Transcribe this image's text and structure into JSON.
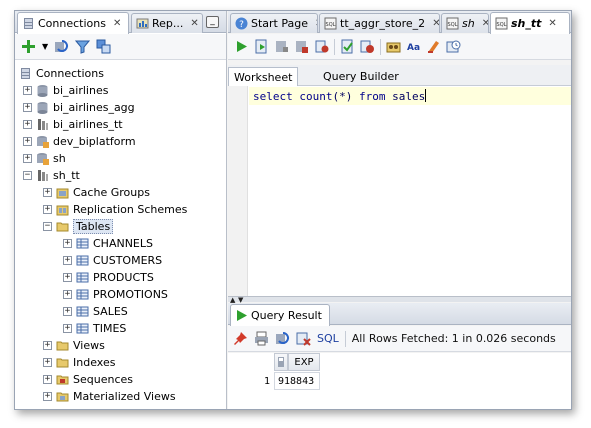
{
  "colors": {
    "accent": "#1e3fa0",
    "editor_line": "#ffffdd",
    "selection": "#dde6f3"
  },
  "left_panel": {
    "tabs": [
      {
        "label": "Connections",
        "icon": "connections-icon",
        "active": true
      },
      {
        "label": "Rep...",
        "icon": "reports-icon",
        "active": false
      }
    ],
    "toolbar": {
      "items": [
        "add-connection-icon",
        "dropdown-arrow-icon",
        "refresh-icon",
        "filter-icon",
        "schema-browser-icon"
      ]
    },
    "tree": {
      "root": "Connections",
      "connections": [
        "bi_airlines",
        "bi_airlines_agg",
        "bi_airlines_tt",
        "dev_biplatform",
        "sh",
        "sh_tt"
      ],
      "sh_tt_children": [
        "Cache Groups",
        "Replication Schemes",
        "Tables",
        "Views",
        "Indexes",
        "Sequences",
        "Materialized Views"
      ],
      "tables": [
        "CHANNELS",
        "CUSTOMERS",
        "PRODUCTS",
        "PROMOTIONS",
        "SALES",
        "TIMES"
      ]
    }
  },
  "editor_panel": {
    "tabs": [
      {
        "label": "Start Page",
        "icon": "help-icon"
      },
      {
        "label": "tt_aggr_store_2",
        "icon": "sql-icon"
      },
      {
        "label": "sh",
        "icon": "sql-icon"
      },
      {
        "label": "sh_tt",
        "icon": "sql-icon",
        "active": true
      }
    ],
    "toolbar": [
      "run-statement-icon",
      "run-script-icon",
      "commit-icon",
      "rollback-icon",
      "cancel-icon",
      "explain-plan-icon",
      "autotrace-icon",
      "sql-tuning-icon",
      "uppercase-icon",
      "clear-icon",
      "history-icon"
    ],
    "sub_tabs": [
      "Worksheet",
      "Query Builder"
    ],
    "code": {
      "kw1": "select",
      "fn": "count",
      "arg": "(*)",
      "kw2": "from",
      "table": "sales"
    },
    "result": {
      "tab": "Query Result",
      "toolbar": {
        "sql_label": "SQL",
        "status": "All Rows Fetched: 1 in 0.026 seconds"
      },
      "column_header": "EXP",
      "rows": [
        {
          "num": "1",
          "value": "918843"
        }
      ]
    }
  }
}
